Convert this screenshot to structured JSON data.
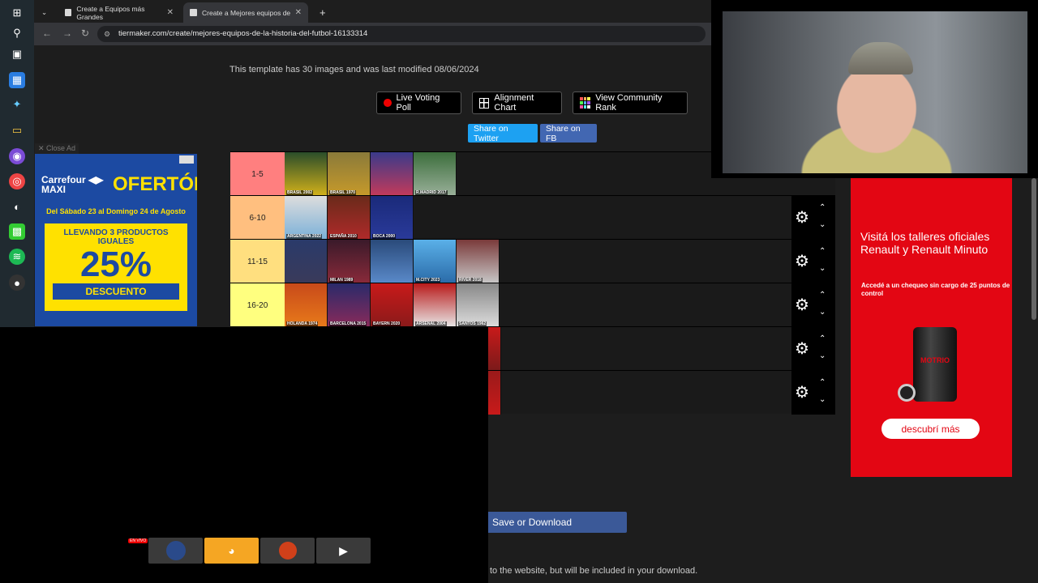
{
  "browser": {
    "tabs": [
      {
        "title": "Create a Equipos más Grandes",
        "active": false
      },
      {
        "title": "Create a Mejores equipos de la",
        "active": true
      }
    ],
    "new_tab_symbol": "+",
    "url": "tiermaker.com/create/mejores-equipos-de-la-historia-del-futbol-16133314"
  },
  "page": {
    "template_info": "This template has 30 images and was last modified 08/06/2024",
    "buttons": {
      "live_poll": "Live Voting Poll",
      "alignment": "Alignment Chart",
      "community": "View Community Rank",
      "twitter": "Share on Twitter",
      "facebook": "Share on FB",
      "save": "Save or Download"
    },
    "footer_note": "to the website, but will be included in your download."
  },
  "tiers": [
    {
      "label": "1-5",
      "color": "#ff7f7f",
      "teams": [
        "BRASIL 2002",
        "BRASIL 1970",
        "",
        "R.MADRID 2017"
      ]
    },
    {
      "label": "6-10",
      "color": "#ffbf7f",
      "teams": [
        "ARGENTINA 2022",
        "ESPAÑA 2010",
        "BOCA 2000"
      ]
    },
    {
      "label": "11-15",
      "color": "#ffdf7f",
      "teams": [
        "",
        "MILAN 1989",
        "",
        "M.CITY 2023",
        "RIVER 2018"
      ]
    },
    {
      "label": "16-20",
      "color": "#ffff7f",
      "teams": [
        "HOLANDA 1974",
        "BARCELONA 2015",
        "BAYERN 2020",
        "ARSENAL 2004",
        "SANTOS 1962"
      ]
    },
    {
      "label": "",
      "color": "#1a1a1a",
      "teams": []
    },
    {
      "label": "",
      "color": "#1a1a1a",
      "teams": []
    }
  ],
  "ads": {
    "close_ad": "✕ Close Ad",
    "left": {
      "brand_line1": "Carrefour",
      "brand_line2": "MAXI",
      "headline": "OFERTÓN",
      "dates": "Del Sábado 23 al Domingo 24 de Agosto",
      "offer_line": "LLEVANDO 3 PRODUCTOS IGUALES",
      "percent": "25%",
      "discount": "DESCUENTO"
    },
    "right": {
      "headline": "Visitá los talleres oficiales Renault y Renault Minuto",
      "sub": "Accedé a un chequeo sin cargo de 25 puntos de control",
      "product": "MOTRIO",
      "cta": "descubrí más"
    }
  },
  "overlay": {
    "live_badge": "EN VIVO"
  }
}
